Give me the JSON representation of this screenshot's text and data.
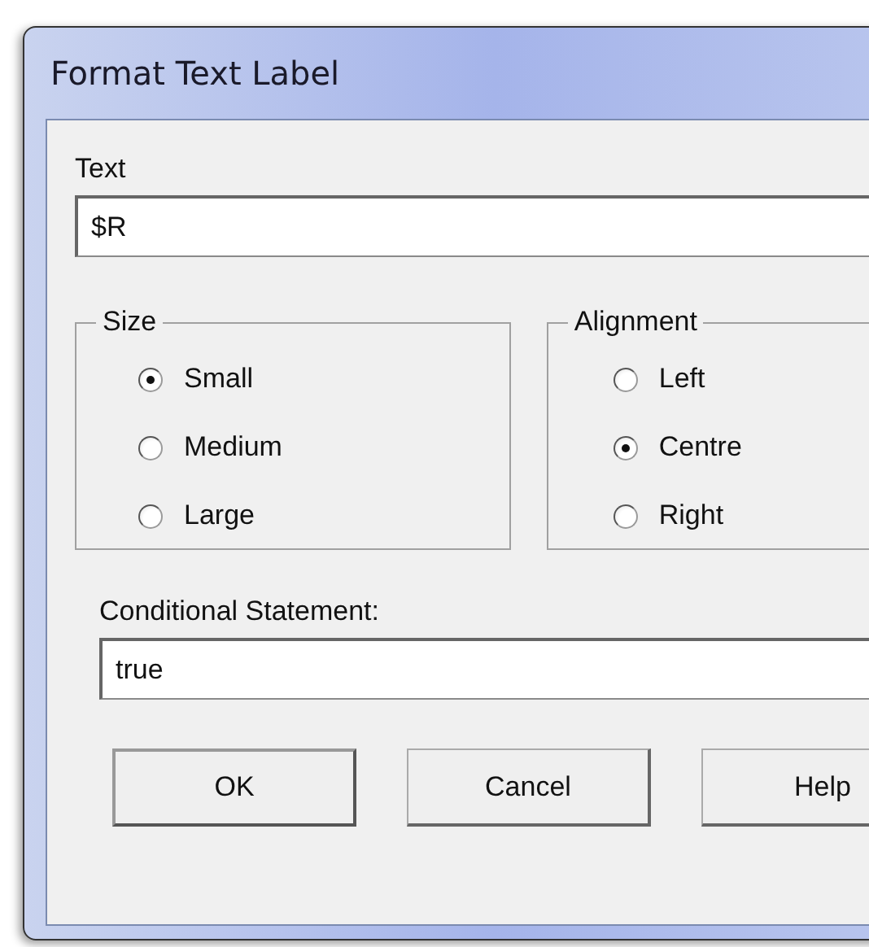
{
  "window": {
    "title": "Format Text Label"
  },
  "text_field": {
    "label": "Text",
    "value": "$R"
  },
  "size_group": {
    "title": "Size",
    "options": [
      {
        "label": "Small",
        "selected": true
      },
      {
        "label": "Medium",
        "selected": false
      },
      {
        "label": "Large",
        "selected": false
      }
    ]
  },
  "alignment_group": {
    "title": "Alignment",
    "options": [
      {
        "label": "Left",
        "selected": false
      },
      {
        "label": "Centre",
        "selected": true
      },
      {
        "label": "Right",
        "selected": false
      }
    ]
  },
  "condition_field": {
    "label": "Conditional Statement:",
    "value": "true"
  },
  "buttons": [
    "OK",
    "Cancel",
    "Help"
  ]
}
